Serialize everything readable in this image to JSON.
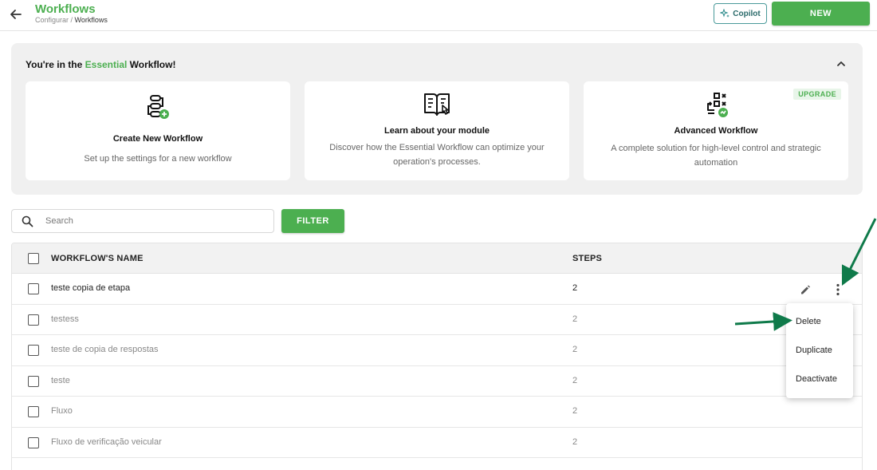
{
  "header": {
    "title": "Workflows",
    "breadcrumb_parent": "Configurar",
    "breadcrumb_sep": " / ",
    "breadcrumb_current": "Workflows",
    "copilot_label": "Copilot",
    "new_label": "NEW"
  },
  "banner": {
    "title_prefix": "You're in the ",
    "title_highlight": "Essential",
    "title_suffix": " Workflow!",
    "cards": [
      {
        "title": "Create New Workflow",
        "description": "Set up the settings for a new workflow",
        "icon": "workflow-add-icon"
      },
      {
        "title": "Learn about your module",
        "description": "Discover how the Essential Workflow can optimize your operation's processes.",
        "icon": "book-icon"
      },
      {
        "title": "Advanced Workflow",
        "description": "A complete solution for high-level control and strategic automation",
        "badge": "UPGRADE",
        "icon": "advanced-workflow-icon"
      }
    ]
  },
  "search": {
    "placeholder": "Search",
    "value": ""
  },
  "filter_label": "FILTER",
  "table": {
    "columns": [
      "WORKFLOW'S NAME",
      "STEPS"
    ],
    "rows": [
      {
        "name": "teste copia de etapa",
        "steps": "2"
      },
      {
        "name": "testess",
        "steps": "2"
      },
      {
        "name": "teste de copia de respostas",
        "steps": "2"
      },
      {
        "name": "teste",
        "steps": "2"
      },
      {
        "name": "Fluxo",
        "steps": "2"
      },
      {
        "name": "Fluxo de verificação veicular",
        "steps": "2"
      }
    ]
  },
  "context_menu": {
    "items": [
      "Delete",
      "Duplicate",
      "Deactivate"
    ]
  },
  "colors": {
    "accent": "#4caf50",
    "annotation_arrow": "#0f7a4a"
  }
}
